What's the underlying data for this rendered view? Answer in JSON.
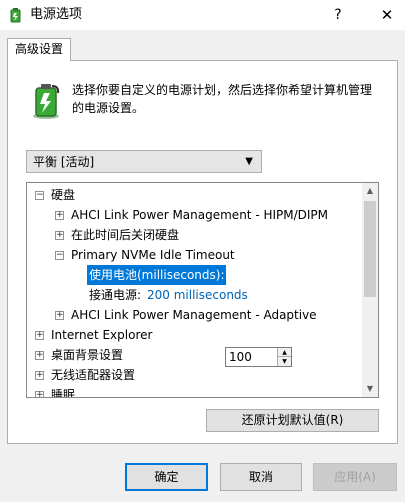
{
  "window": {
    "title": "电源选项",
    "help_glyph": "?",
    "close_glyph": "✕"
  },
  "tab": {
    "label": "高级设置"
  },
  "description": "选择你要自定义的电源计划，然后选择你希望计算机管理的电源设置。",
  "plan_select": {
    "value": "平衡 [活动]"
  },
  "tree": {
    "harddisk": {
      "label": "硬盘",
      "expander": "⊟"
    },
    "ahci_hipm": {
      "label": "AHCI Link Power Management - HIPM/DIPM",
      "expander": "⊞"
    },
    "turn_off_disk": {
      "label": "在此时间后关闭硬盘",
      "expander": "⊞"
    },
    "nvme_idle": {
      "label": "Primary NVMe Idle Timeout",
      "expander": "⊟"
    },
    "on_battery": {
      "label": "使用电池(milliseconds):",
      "value": "100"
    },
    "plugged_in": {
      "label": "接通电源:",
      "value": "200 milliseconds"
    },
    "ahci_adaptive": {
      "label": "AHCI Link Power Management - Adaptive",
      "expander": "⊞"
    },
    "ie": {
      "label": "Internet Explorer",
      "expander": "⊞"
    },
    "desktop_bg": {
      "label": "桌面背景设置",
      "expander": "⊞"
    },
    "wireless": {
      "label": "无线适配器设置",
      "expander": "⊞"
    },
    "sleep": {
      "label": "睡眠",
      "expander": "⊞"
    }
  },
  "buttons": {
    "restore": "还原计划默认值(R)",
    "ok": "确定",
    "cancel": "取消",
    "apply": "应用(A)"
  },
  "colors": {
    "selection": "#0078d7",
    "link_value": "#0063b1",
    "battery_green": "#3aa935"
  }
}
